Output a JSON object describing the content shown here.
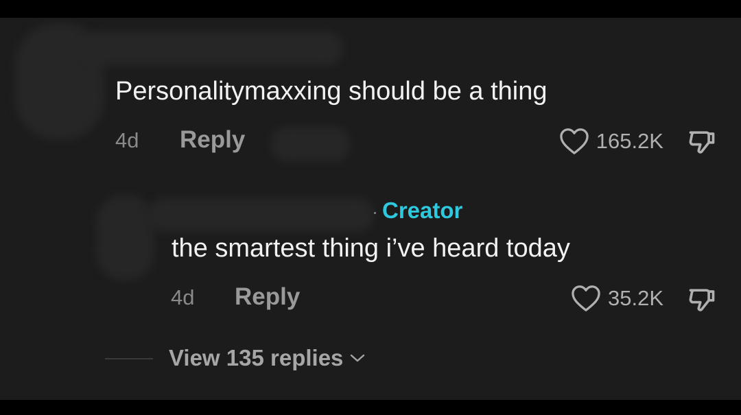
{
  "comments": [
    {
      "text": "Personalitymaxxing should be a thing",
      "time": "4d",
      "reply_label": "Reply",
      "likes": "165.2K"
    },
    {
      "badge": "Creator",
      "text": "the smartest thing i’ve heard today",
      "time": "4d",
      "reply_label": "Reply",
      "likes": "35.2K"
    }
  ],
  "view_replies": {
    "label": "View 135 replies"
  },
  "icons": {
    "like": "heart-outline-icon",
    "dislike": "thumbs-down-icon",
    "expand": "chevron-down-icon"
  },
  "colors": {
    "background": "#1c1c1c",
    "creator_badge": "#2fc9df",
    "primary_text": "#f2f2f2",
    "secondary_text": "#9a9a9a"
  }
}
